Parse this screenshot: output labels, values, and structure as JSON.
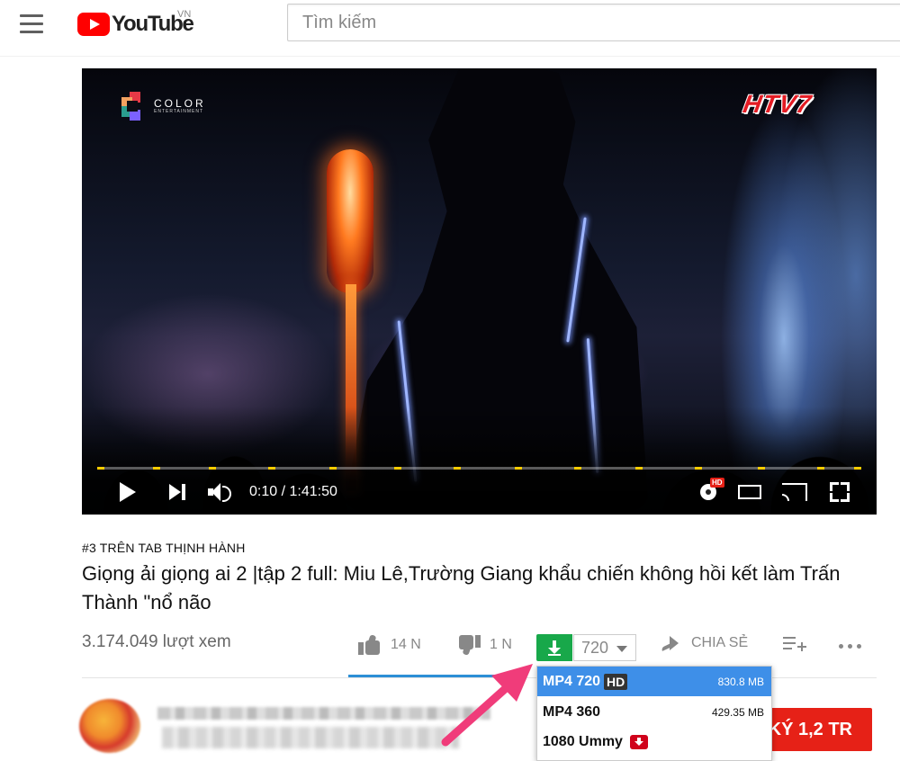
{
  "header": {
    "logo_text": "YouTube",
    "region": "VN",
    "search_placeholder": "Tìm kiếm"
  },
  "player": {
    "brand_word": "COLOR",
    "brand_sub": "ENTERTAINMENT",
    "channel_logo": "HTV7",
    "time": "0:10 / 1:41:50",
    "progress_fraction": 0.0016,
    "hd_badge": "HD"
  },
  "video": {
    "trending": "#3 TRÊN TAB THỊNH HÀNH",
    "title": "Giọng ải giọng ai 2 |tập 2 full: Miu Lê,Trường Giang khẩu chiến không hồi kết làm Trấn Thành \"nổ não",
    "views": "3.174.049 lượt xem",
    "likes": "14 N",
    "dislikes": "1 N",
    "share": "CHIA SẺ",
    "like_ratio": 0.93
  },
  "downloader": {
    "selected_quality": "720",
    "options": [
      {
        "label": "MP4 720",
        "tag": "HD",
        "size": "830.8 MB"
      },
      {
        "label": "MP4 360",
        "tag": "",
        "size": "429.35 MB"
      },
      {
        "label": "1080 Ummy",
        "tag": "",
        "size": ""
      }
    ]
  },
  "channel": {
    "subscribe_label": "KÝ  1,2 TR"
  },
  "colors": {
    "youtube_red": "#ff0000",
    "download_green": "#18a84a",
    "selection_blue": "#3e8fe8",
    "subscribe_red": "#e62117",
    "annotation_pink": "#f03c7a",
    "timeline_marker": "#ffcc00"
  }
}
